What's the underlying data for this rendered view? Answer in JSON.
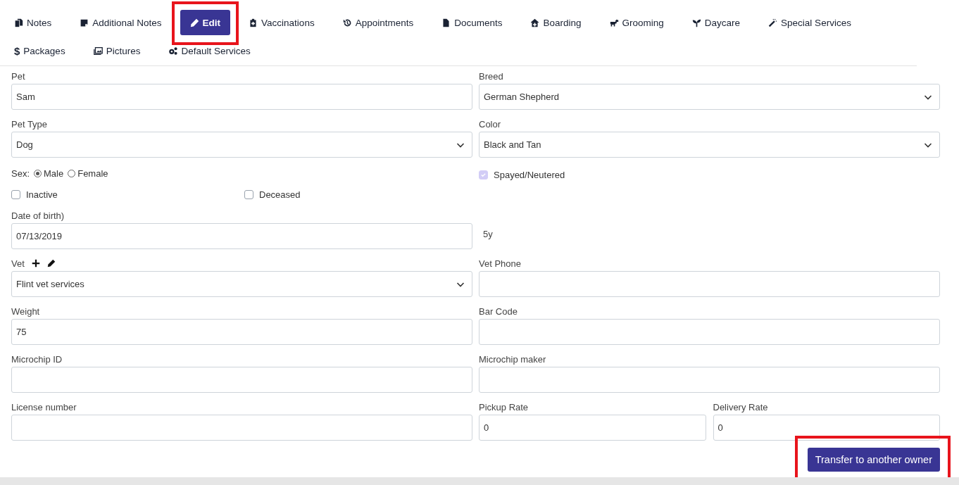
{
  "tabs": [
    {
      "label": "Notes",
      "selected": false,
      "highlighted": false
    },
    {
      "label": "Additional Notes",
      "selected": false,
      "highlighted": false
    },
    {
      "label": "Edit",
      "selected": true,
      "highlighted": true
    },
    {
      "label": "Vaccinations",
      "selected": false,
      "highlighted": false
    },
    {
      "label": "Appointments",
      "selected": false,
      "highlighted": false
    },
    {
      "label": "Documents",
      "selected": false,
      "highlighted": false
    },
    {
      "label": "Boarding",
      "selected": false,
      "highlighted": false
    },
    {
      "label": "Grooming",
      "selected": false,
      "highlighted": false
    },
    {
      "label": "Daycare",
      "selected": false,
      "highlighted": false
    },
    {
      "label": "Special Services",
      "selected": false,
      "highlighted": false
    },
    {
      "label": "Packages",
      "selected": false,
      "highlighted": false,
      "icon_text": "$"
    },
    {
      "label": "Pictures",
      "selected": false,
      "highlighted": false
    },
    {
      "label": "Default Services",
      "selected": false,
      "highlighted": false
    }
  ],
  "form": {
    "rows": [
      {
        "cells": [
          {
            "kind": "input",
            "label": "Pet",
            "value": "Sam"
          },
          {
            "kind": "select",
            "label": "Breed",
            "value": "German Shepherd"
          }
        ]
      },
      {
        "cells": [
          {
            "kind": "select",
            "label": "Pet Type",
            "value": "Dog"
          },
          {
            "kind": "select",
            "label": "Color",
            "value": "Black and Tan"
          }
        ]
      },
      {
        "cells": [
          {
            "kind": "radios",
            "label": "Sex:",
            "options": [
              {
                "label": "Male",
                "selected": true
              },
              {
                "label": "Female",
                "selected": false
              }
            ]
          },
          {
            "kind": "checks",
            "items": [
              {
                "label": "Spayed/Neutered",
                "checked": true,
                "disabled": true
              }
            ]
          }
        ]
      },
      {
        "cells": [
          {
            "kind": "checks",
            "items": [
              {
                "label": "Inactive",
                "checked": false
              },
              {
                "label": "Deceased",
                "checked": false
              }
            ]
          }
        ]
      },
      {
        "cells": [
          {
            "kind": "input",
            "label": "Date of birth)",
            "value": "07/13/2019"
          },
          {
            "kind": "note",
            "value": "5y"
          }
        ]
      },
      {
        "cells": [
          {
            "kind": "select",
            "label": "Vet",
            "value": "Flint vet services",
            "actions": true
          },
          {
            "kind": "input",
            "label": "Vet Phone"
          }
        ]
      },
      {
        "cells": [
          {
            "kind": "input",
            "label": "Weight",
            "value": "75"
          },
          {
            "kind": "input",
            "label": "Bar Code"
          }
        ]
      },
      {
        "cells": [
          {
            "kind": "input",
            "label": "Microchip ID"
          },
          {
            "kind": "input",
            "label": "Microchip maker"
          }
        ]
      },
      {
        "cells": [
          {
            "kind": "input",
            "label": "License number"
          },
          {
            "kind": "split",
            "cells": [
              {
                "kind": "input",
                "label": "Pickup Rate",
                "value": "0"
              },
              {
                "kind": "input",
                "label": "Delivery Rate",
                "value": "0"
              }
            ]
          }
        ]
      }
    ],
    "button": {
      "label": "Transfer to another owner",
      "highlighted": true
    }
  }
}
